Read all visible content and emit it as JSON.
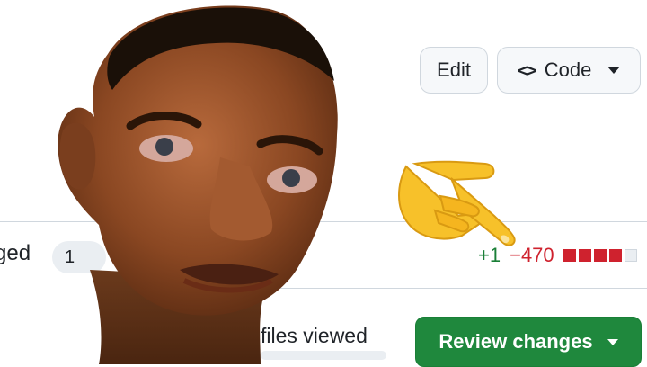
{
  "header": {
    "edit_label": "Edit",
    "code_glyph": "<>",
    "code_label": "Code"
  },
  "stats": {
    "left_fragment": "ged",
    "count_fragment": "1",
    "additions": "+1",
    "deletions": "−470",
    "diff_squares": [
      "red",
      "red",
      "red",
      "red",
      "grey"
    ]
  },
  "toolbar": {
    "files_viewed_label": "files viewed",
    "review_label": "Review changes"
  },
  "overlays": {
    "pointing_emoji": "backhand-index-pointing-down-right",
    "face_image": "meme-face-photo"
  },
  "colors": {
    "additions": "#1a7f37",
    "deletions": "#cf222e",
    "review_button": "#1f883d",
    "emoji_yellow": "#f7c12a"
  }
}
